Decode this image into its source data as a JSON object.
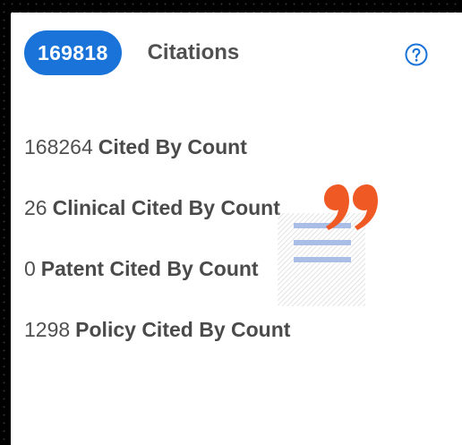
{
  "summary": {
    "badge_value": "169818",
    "badge_label": "Citations"
  },
  "help": {
    "icon": "question-circle-icon",
    "color": "#1a73d9"
  },
  "rows": [
    {
      "value": "168264",
      "label": "Cited By Count"
    },
    {
      "value": "26",
      "label": "Clinical Cited By Count"
    },
    {
      "value": "0",
      "label": "Patent Cited By Count"
    },
    {
      "value": "1298",
      "label": "Policy Cited By Count"
    }
  ],
  "colors": {
    "accent": "#1a73d9",
    "quote_mark": "#ef5a24",
    "quote_lines": "#a9bde6"
  }
}
